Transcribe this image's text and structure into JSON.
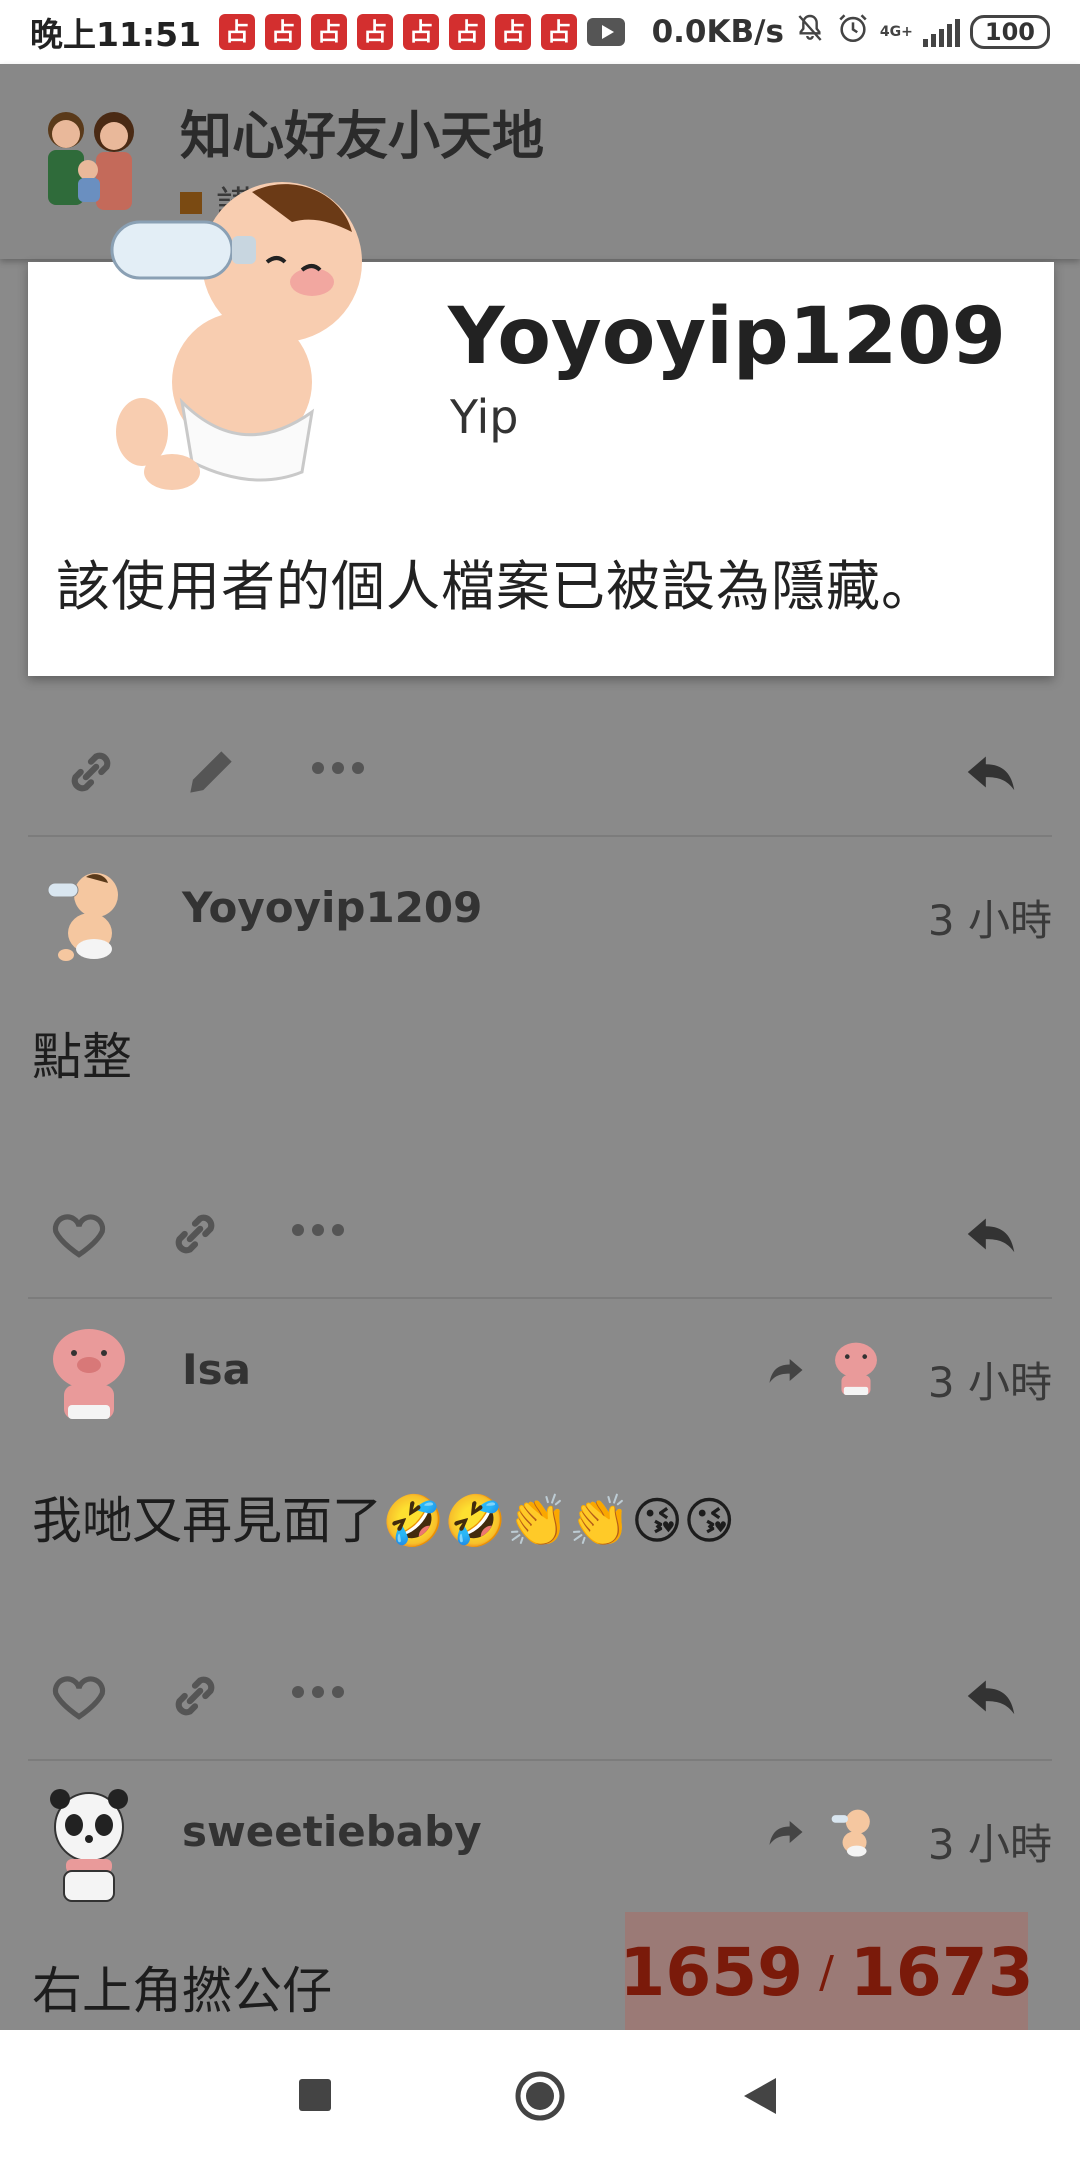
{
  "status_bar": {
    "time": "晚上11:51",
    "notification_glyph": "占",
    "notification_count": 8,
    "net_speed": "0.0KB/s",
    "net_type": "4G+",
    "battery": "100"
  },
  "header": {
    "title": "知心好友小天地",
    "subtitle": "講場"
  },
  "modal": {
    "username": "Yoyoyip1209",
    "name": "Yip",
    "message": "該使用者的個人檔案已被設為隱藏。"
  },
  "posts": [
    {
      "username": "Yoyoyip1209",
      "time": "3 小時",
      "text": "點整",
      "avatar": "baby-bottle-avatar"
    },
    {
      "username": "Isa",
      "time": "3 小時",
      "text": "我哋又再見面了🤣🤣👏👏😘😘",
      "avatar": "pig-avatar",
      "reply_to_avatar": "pig-avatar"
    },
    {
      "username": "sweetiebaby",
      "time": "3 小時",
      "text": "右上角撚公仔",
      "avatar": "panda-avatar",
      "reply_to_avatar": "baby-bottle-avatar"
    }
  ],
  "progress": {
    "current": "1659",
    "separator": "/",
    "total": "1673"
  },
  "colors": {
    "counter_bg": "#9b7a76",
    "counter_text": "#7a1a0a",
    "notification": "#d32f2f"
  }
}
